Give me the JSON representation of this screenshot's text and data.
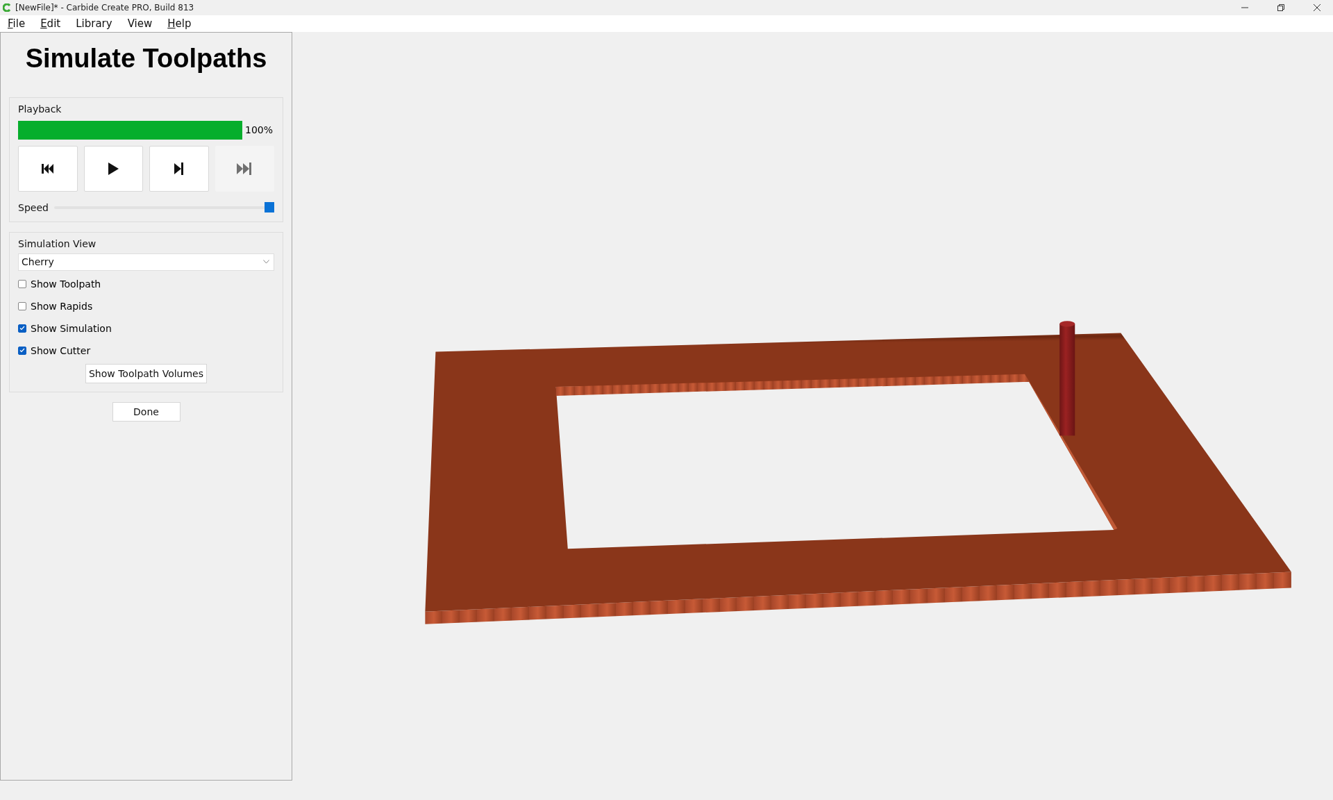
{
  "window": {
    "title": "[NewFile]* - Carbide Create PRO, Build 813"
  },
  "menu": [
    {
      "label": "File",
      "mnemonic": true
    },
    {
      "label": "Edit",
      "mnemonic": true
    },
    {
      "label": "Library",
      "mnemonic": false
    },
    {
      "label": "View",
      "mnemonic": false
    },
    {
      "label": "Help",
      "mnemonic": true
    }
  ],
  "panel": {
    "title": "Simulate Toolpaths",
    "playback": {
      "label": "Playback",
      "progress": {
        "level": 1,
        "reading": "100%"
      },
      "buttons": [
        {
          "kind": "rewind",
          "disabled": false
        },
        {
          "kind": "play",
          "disabled": false
        },
        {
          "kind": "step",
          "disabled": false
        },
        {
          "kind": "end",
          "disabled": true
        }
      ],
      "speed": {
        "label": "Speed",
        "level": 1
      }
    },
    "simulation_view": {
      "label": "Simulation View",
      "material": "Cherry",
      "options": [
        {
          "label": "Show Toolpath",
          "checked": false
        },
        {
          "label": "Show Rapids",
          "checked": false
        },
        {
          "label": "Show Simulation",
          "checked": true
        },
        {
          "label": "Show Cutter",
          "checked": true
        }
      ],
      "volumes_button": "Show Toolpath Volumes"
    },
    "done_button": "Done"
  }
}
